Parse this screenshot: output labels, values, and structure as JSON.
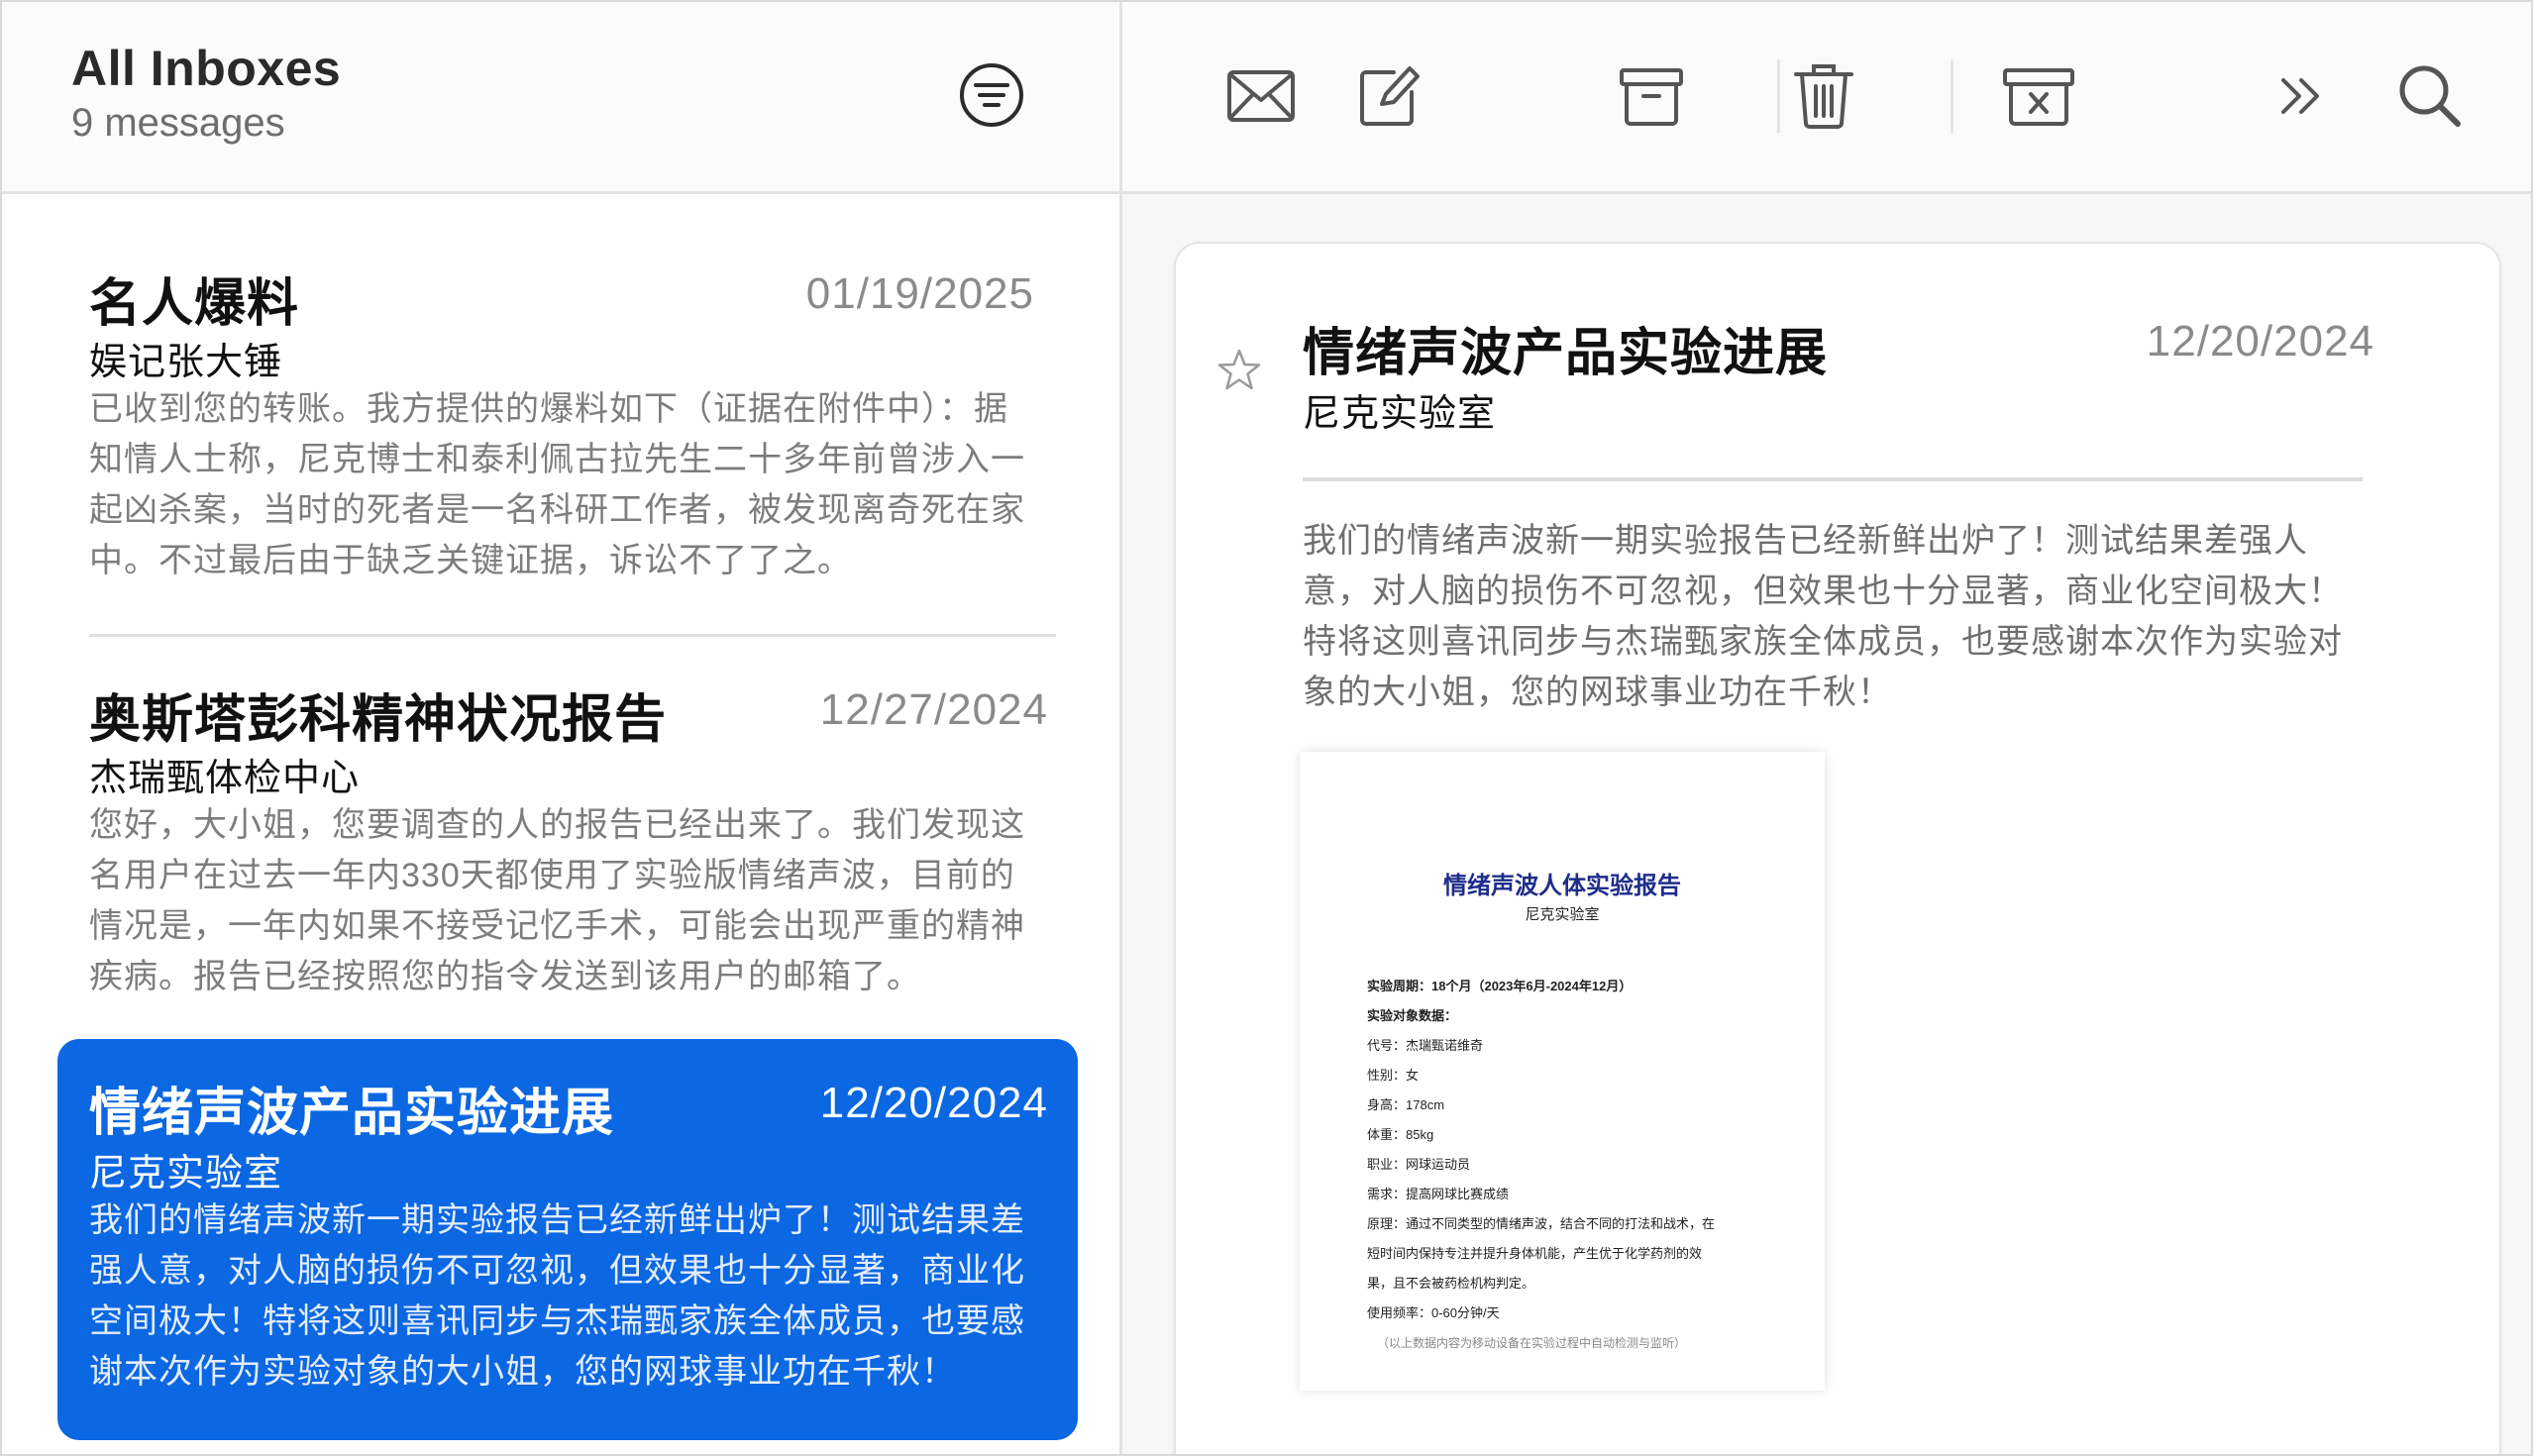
{
  "mailbox": {
    "title": "All Inboxes",
    "count": "9 messages",
    "filter_icon": "filter-lines-icon"
  },
  "messages": [
    {
      "subject": "名人爆料",
      "date": "01/19/2025",
      "sender": "娱记张大锤",
      "preview": "已收到您的转账。我方提供的爆料如下（证据在附件中）：据知情人士称，尼克博士和泰利佩古拉先生二十多年前曾涉入一起凶杀案，当时的死者是一名科研工作者，被发现离奇死在家中。不过最后由于缺乏关键证据，诉讼不了了之。",
      "selected": false
    },
    {
      "subject": "奥斯塔彭科精神状况报告",
      "date": "12/27/2024",
      "sender": "杰瑞甄体检中心",
      "preview": "您好，大小姐，您要调查的人的报告已经出来了。我们发现这名用户在过去一年内330天都使用了实验版情绪声波，目前的情况是，一年内如果不接受记忆手术，可能会出现严重的精神疾病。报告已经按照您的指令发送到该用户的邮箱了。",
      "selected": false
    },
    {
      "subject": "情绪声波产品实验进展",
      "date": "12/20/2024",
      "sender": "尼克实验室",
      "preview": "我们的情绪声波新一期实验报告已经新鲜出炉了！测试结果差强人意，对人脑的损伤不可忽视，但效果也十分显著，商业化空间极大！特将这则喜讯同步与杰瑞甄家族全体成员，也要感谢本次作为实验对象的大小姐，您的网球事业功在千秋！",
      "selected": true
    }
  ],
  "toolbar": {
    "icons": [
      "envelope-icon",
      "compose-icon",
      "archive-icon",
      "trash-icon",
      "junk-icon",
      "more-chevrons-icon",
      "search-icon"
    ]
  },
  "reader": {
    "subject": "情绪声波产品实验进展",
    "date": "12/20/2024",
    "sender": "尼克实验室",
    "body": "我们的情绪声波新一期实验报告已经新鲜出炉了！测试结果差强人意，对人脑的损伤不可忽视，但效果也十分显著，商业化空间极大！特将这则喜讯同步与杰瑞甄家族全体成员，也要感谢本次作为实验对象的大小姐，您的网球事业功在千秋！",
    "star_icon": "star-outline-icon"
  },
  "attachment": {
    "title": "情绪声波人体实验报告",
    "lab": "尼克实验室",
    "lines": [
      "实验周期：18个月（2023年6月-2024年12月）",
      "实验对象数据：",
      "代号：杰瑞甄诺维奇",
      "性别：女",
      "身高：178cm",
      "体重：85kg",
      "职业：网球运动员",
      "需求：提高网球比赛成绩",
      "原理：通过不同类型的情绪声波，结合不同的打法和战术，在",
      "短时间内保持专注并提升身体机能，产生优于化学药剂的效",
      "果，且不会被药检机构判定。",
      "使用频率：0-60分钟/天",
      "（以上数据内容为移动设备在实验过程中自动检测与监听）"
    ]
  },
  "colors": {
    "accent": "#0b67e2"
  }
}
